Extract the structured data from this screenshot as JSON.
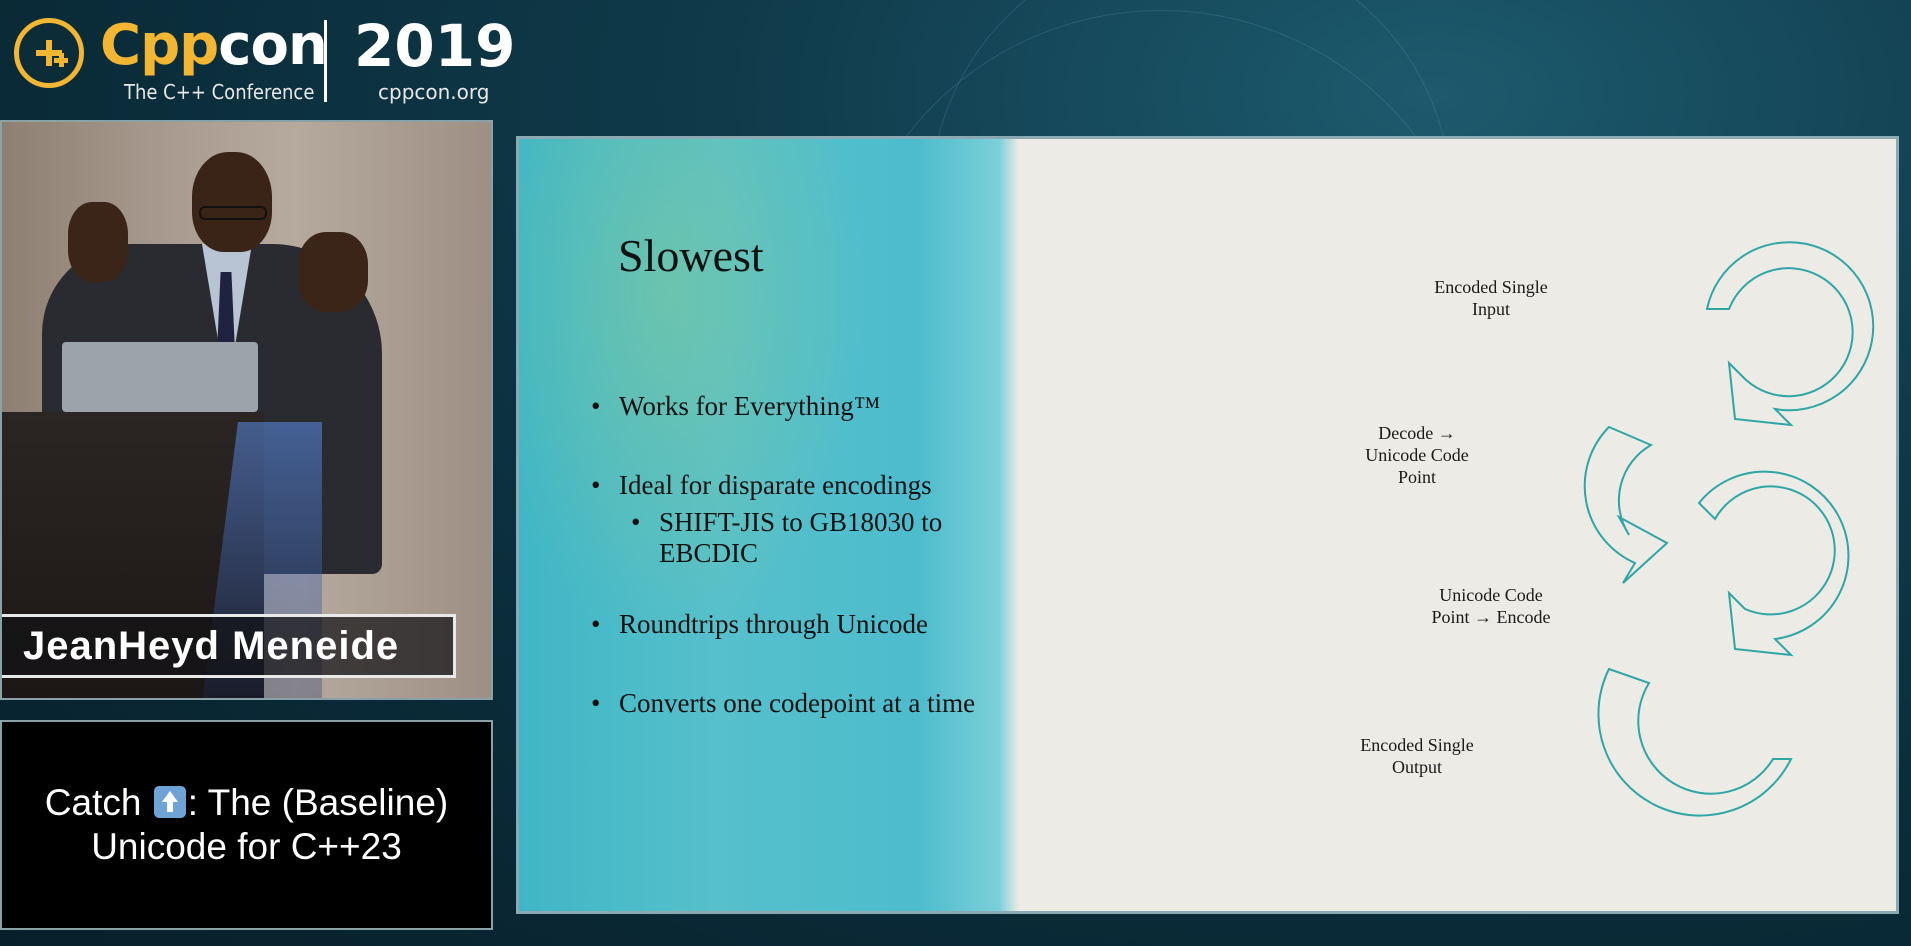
{
  "header": {
    "brand_cpp": "Cpp",
    "brand_con": "con",
    "tagline": "The C++ Conference",
    "year": "2019",
    "site": "cppcon.org",
    "accent_color": "#f2b632"
  },
  "speaker": {
    "name": "JeanHeyd Meneide"
  },
  "talk": {
    "title_line1_before": "Catch ",
    "title_line1_icon": "up-arrow-emoji",
    "title_line1_after": ": The (Baseline)",
    "title_line2": "Unicode for C++23"
  },
  "slide": {
    "title": "Slowest",
    "bullets": [
      {
        "text": "Works for Everything™"
      },
      {
        "text": "Ideal for disparate encodings",
        "sub": "SHIFT-JIS to GB18030 to EBCDIC"
      },
      {
        "text": "Roundtrips through Unicode"
      },
      {
        "text": "Converts one codepoint at a time"
      }
    ],
    "diagram": {
      "steps": [
        [
          "Encoded Single",
          "Input"
        ],
        [
          "Decode →",
          "Unicode Code",
          "Point"
        ],
        [
          "Unicode Code",
          "Point → Encode"
        ],
        [
          "Encoded Single",
          "Output"
        ]
      ],
      "arrow_color": "#2fa6a6"
    }
  }
}
